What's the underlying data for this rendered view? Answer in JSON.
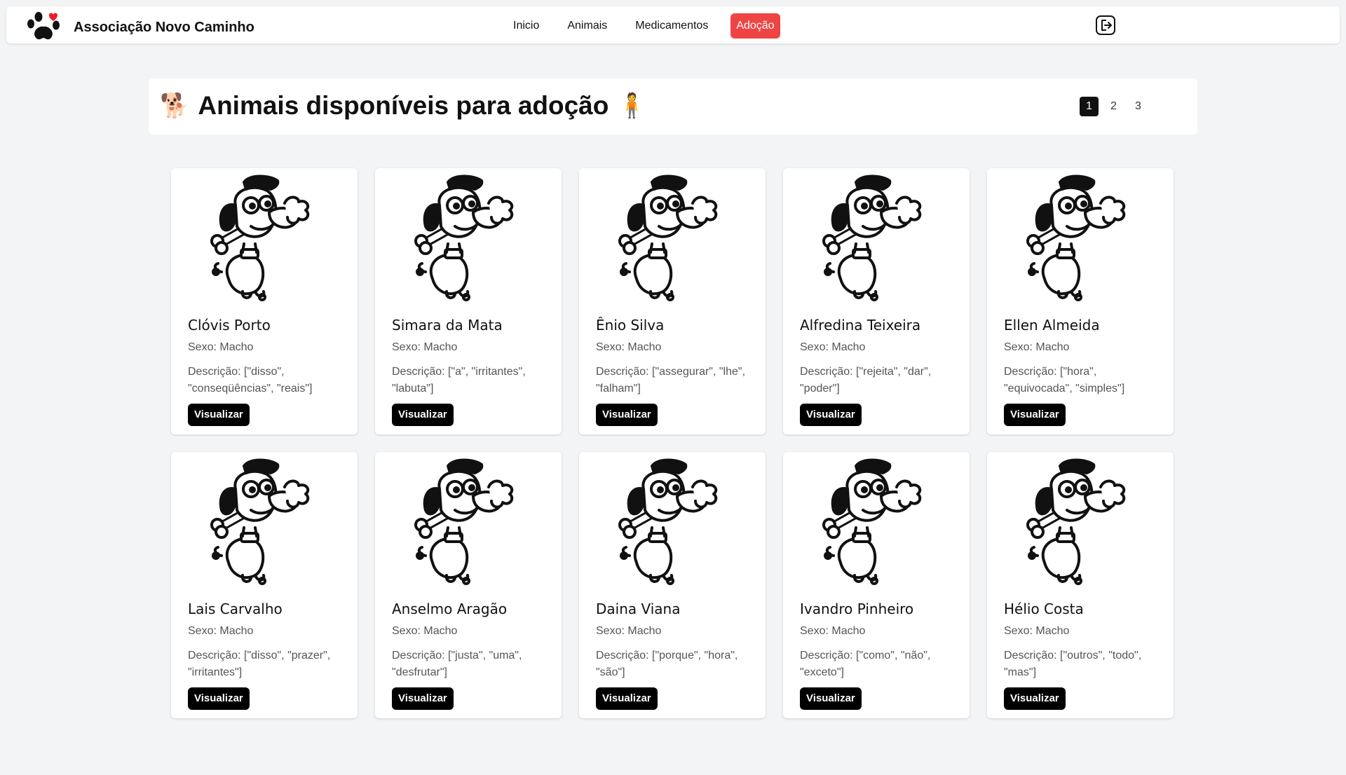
{
  "nav": {
    "brand": "Associação Novo Caminho",
    "links": [
      {
        "label": "Inicio",
        "active": false
      },
      {
        "label": "Animais",
        "active": false
      },
      {
        "label": "Medicamentos",
        "active": false
      },
      {
        "label": "Adoção",
        "active": true
      }
    ],
    "accent": "#ef4444"
  },
  "header": {
    "emoji_left": "🐕",
    "title": "Animais disponíveis para adoção",
    "emoji_right": "🧍"
  },
  "pagination": {
    "pages": [
      "1",
      "2",
      "3"
    ],
    "current": "1"
  },
  "animals": [
    {
      "name": "Clóvis Porto",
      "sex": "Sexo: Macho",
      "desc": "Descrição: [\"disso\", \"conseqüências\", \"reais\"]",
      "button": "Visualizar"
    },
    {
      "name": "Simara da Mata",
      "sex": "Sexo: Macho",
      "desc": "Descrição: [\"a\", \"irritantes\", \"labuta\"]",
      "button": "Visualizar"
    },
    {
      "name": "Ênio Silva",
      "sex": "Sexo: Macho",
      "desc": "Descrição: [\"assegurar\", \"lhe\", \"falham\"]",
      "button": "Visualizar"
    },
    {
      "name": "Alfredina Teixeira",
      "sex": "Sexo: Macho",
      "desc": "Descrição: [\"rejeita\", \"dar\", \"poder\"]",
      "button": "Visualizar"
    },
    {
      "name": "Ellen Almeida",
      "sex": "Sexo: Macho",
      "desc": "Descrição: [\"hora\", \"equivocada\", \"simples\"]",
      "button": "Visualizar"
    },
    {
      "name": "Lais Carvalho",
      "sex": "Sexo: Macho",
      "desc": "Descrição: [\"disso\", \"prazer\", \"irritantes\"]",
      "button": "Visualizar"
    },
    {
      "name": "Anselmo Aragão",
      "sex": "Sexo: Macho",
      "desc": "Descrição: [\"justa\", \"uma\", \"desfrutar\"]",
      "button": "Visualizar"
    },
    {
      "name": "Daina Viana",
      "sex": "Sexo: Macho",
      "desc": "Descrição: [\"porque\", \"hora\", \"são\"]",
      "button": "Visualizar"
    },
    {
      "name": "Ivandro Pinheiro",
      "sex": "Sexo: Macho",
      "desc": "Descrição: [\"como\", \"não\", \"exceto\"]",
      "button": "Visualizar"
    },
    {
      "name": "Hélio Costa",
      "sex": "Sexo: Macho",
      "desc": "Descrição: [\"outros\", \"todo\", \"mas\"]",
      "button": "Visualizar"
    }
  ],
  "icons": {
    "logo": "paw-heart-icon",
    "logout": "logout-icon",
    "animal_image": "dog-with-bone-icon"
  }
}
